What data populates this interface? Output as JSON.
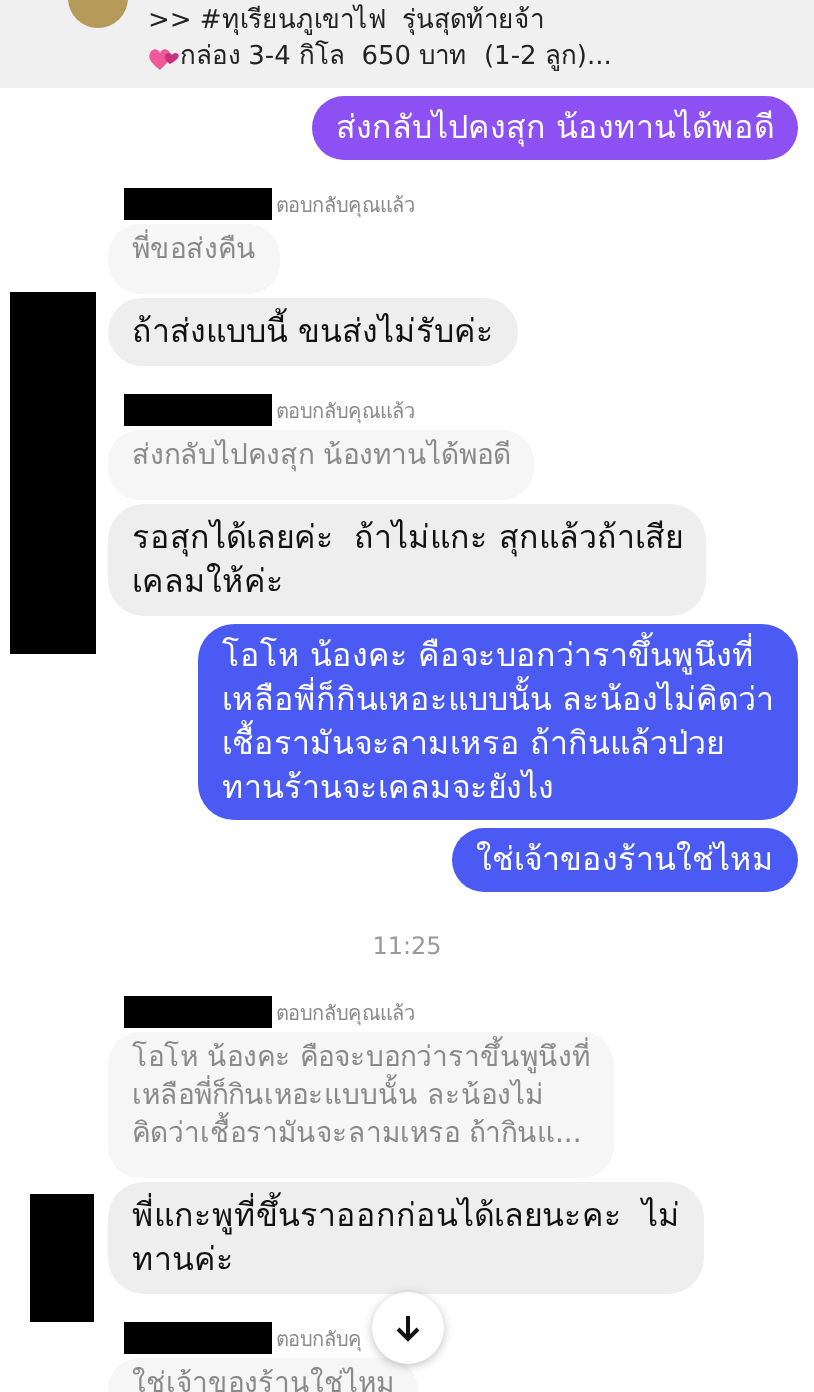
{
  "pinned": {
    "lines": [
      ">> #ทุเรียนภูเขาไฟ  รุ่นสุดท้ายจ้า",
      "กล่อง 3-4 กิโล  650 บาท  (1-2 ลูก)..."
    ]
  },
  "messages": [
    {
      "kind": "sent",
      "text": "ส่งกลับไปคงสุก น้องทานได้พอดี",
      "color": "#8c50f3"
    },
    {
      "kind": "reply_header",
      "text": "ตอบกลับคุณแล้ว"
    },
    {
      "kind": "quote",
      "text": "พี่ขอส่งคืน"
    },
    {
      "kind": "received",
      "text": "ถ้าส่งแบบนี้ ขนส่งไม่รับค่ะ"
    },
    {
      "kind": "reply_header",
      "text": "ตอบกลับคุณแล้ว"
    },
    {
      "kind": "quote",
      "text": "ส่งกลับไปคงสุก น้องทานได้พอดี"
    },
    {
      "kind": "received",
      "text": "รอสุกได้เลยค่ะ  ถ้าไม่แกะ สุกแล้วถ้าเสีย\nเคลมให้ค่ะ"
    },
    {
      "kind": "sent",
      "text": "โอโห น้องคะ คือจะบอกว่าราขึ้นพูนึงที่\nเหลือพี่ก็กินเหอะแบบนั้น ละน้องไม่คิดว่า\nเชื้อรามันจะลามเหรอ ถ้ากินแล้วป่วย\nทานร้านจะเคลมจะยังไง",
      "color": "#4b5af2"
    },
    {
      "kind": "sent",
      "text": "ใช่เจ้าของร้านใช่ไหม",
      "color": "#4b5af2"
    },
    {
      "kind": "time",
      "text": "11:25"
    },
    {
      "kind": "reply_header",
      "text": "ตอบกลับคุณแล้ว"
    },
    {
      "kind": "quote",
      "text": "โอโห น้องคะ คือจะบอกว่าราขึ้นพูนึงที่\nเหลือพี่ก็กินเหอะแบบนั้น ละน้องไม่\nคิดว่าเชื้อรามันจะลามเหรอ ถ้ากินแ..."
    },
    {
      "kind": "received",
      "text": "พี่แกะพูที่ขึ้นราออกก่อนได้เลยนะคะ  ไม่\nทานค่ะ"
    },
    {
      "kind": "reply_header",
      "text": "ตอบกลับคุ"
    },
    {
      "kind": "quote",
      "text": "ใช่เจ้าของร้านใช่ไหม"
    }
  ]
}
